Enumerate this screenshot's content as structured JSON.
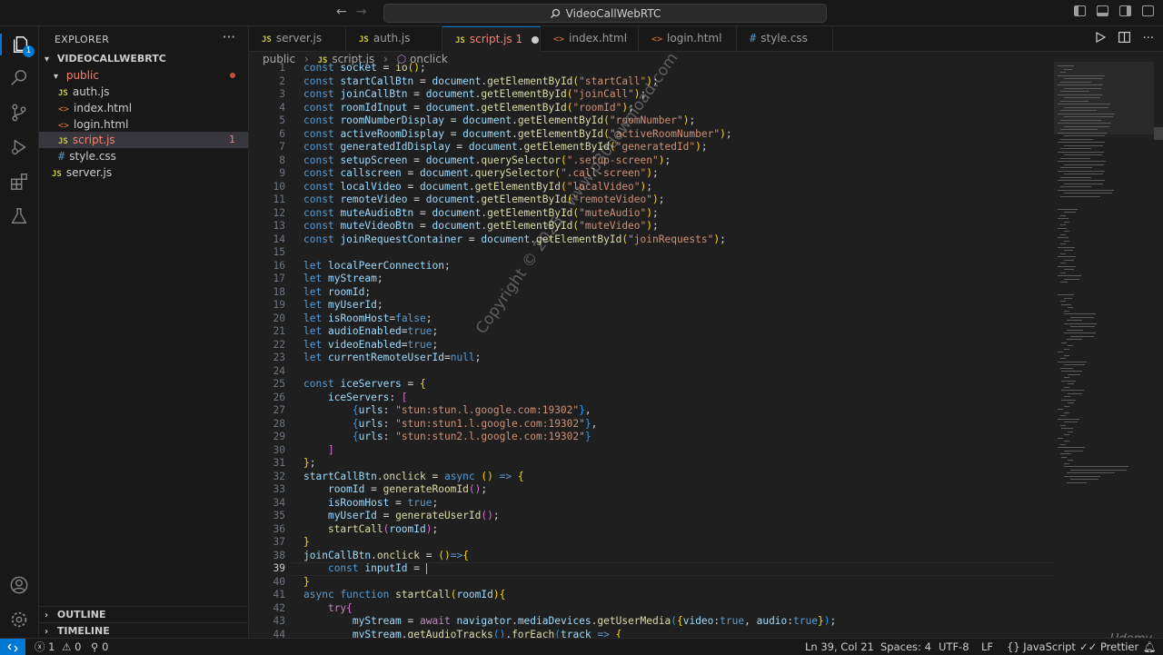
{
  "titlebar": {
    "title": "VideoCallWebRTC",
    "back": "←",
    "forward": "→"
  },
  "sidebar": {
    "title": "EXPLORER",
    "more": "···",
    "project": "VIDEOCALLWEBRTC",
    "folder": "public",
    "files": [
      {
        "name": "auth.js",
        "icon": "JS"
      },
      {
        "name": "index.html",
        "icon": "<>"
      },
      {
        "name": "login.html",
        "icon": "<>"
      },
      {
        "name": "script.js",
        "icon": "JS",
        "problems": "1"
      },
      {
        "name": "style.css",
        "icon": "#"
      }
    ],
    "root_files": [
      {
        "name": "server.js",
        "icon": "JS"
      }
    ],
    "outline": "OUTLINE",
    "timeline": "TIMELINE"
  },
  "activity": {
    "explorer_badge": "1"
  },
  "tabs": [
    {
      "icon": "JS",
      "label": "server.js"
    },
    {
      "icon": "JS",
      "label": "auth.js"
    },
    {
      "icon": "JS",
      "label": "script.js",
      "problems": "1"
    },
    {
      "icon": "<>",
      "label": "index.html"
    },
    {
      "icon": "<>",
      "label": "login.html"
    },
    {
      "icon": "#",
      "label": "style.css"
    }
  ],
  "breadcrumb": {
    "folder": "public",
    "file_icon": "JS",
    "file": "script.js",
    "symbol": "onclick"
  },
  "editor": {
    "current_line": 39,
    "lines": [
      {
        "n": 1,
        "html": "<span class='k'>const</span> <span class='v'>socket</span> = <span class='f'>io</span><span class='p1'>()</span>;"
      },
      {
        "n": 2,
        "html": "<span class='k'>const</span> <span class='v'>startCallBtn</span> = <span class='v'>document</span>.<span class='f'>getElementById</span><span class='p1'>(</span><span class='s'>\"startCall\"</span><span class='p1'>)</span>;"
      },
      {
        "n": 3,
        "html": "<span class='k'>const</span> <span class='v'>joinCallBtn</span> = <span class='v'>document</span>.<span class='f'>getElementById</span><span class='p1'>(</span><span class='s'>\"joinCall\"</span><span class='p1'>)</span>;"
      },
      {
        "n": 4,
        "html": "<span class='k'>const</span> <span class='v'>roomIdInput</span> = <span class='v'>document</span>.<span class='f'>getElementById</span><span class='p1'>(</span><span class='s'>\"roomId\"</span><span class='p1'>)</span>;"
      },
      {
        "n": 5,
        "html": "<span class='k'>const</span> <span class='v'>roomNumberDisplay</span> = <span class='v'>document</span>.<span class='f'>getElementById</span><span class='p1'>(</span><span class='s'>\"roomNumber\"</span><span class='p1'>)</span>;"
      },
      {
        "n": 6,
        "html": "<span class='k'>const</span> <span class='v'>activeRoomDisplay</span> = <span class='v'>document</span>.<span class='f'>getElementById</span><span class='p1'>(</span><span class='s'>\"activeRoomNumber\"</span><span class='p1'>)</span>;"
      },
      {
        "n": 7,
        "html": "<span class='k'>const</span> <span class='v'>generatedIdDisplay</span> = <span class='v'>document</span>.<span class='f'>getElementById</span><span class='p1'>(</span><span class='s'>\"generatedId\"</span><span class='p1'>)</span>;"
      },
      {
        "n": 8,
        "html": "<span class='k'>const</span> <span class='v'>setupScreen</span> = <span class='v'>document</span>.<span class='f'>querySelector</span><span class='p1'>(</span><span class='s'>\".setup-screen\"</span><span class='p1'>)</span>;"
      },
      {
        "n": 9,
        "html": "<span class='k'>const</span> <span class='v'>callscreen</span> = <span class='v'>document</span>.<span class='f'>querySelector</span><span class='p1'>(</span><span class='s'>\".call-screen\"</span><span class='p1'>)</span>;"
      },
      {
        "n": 10,
        "html": "<span class='k'>const</span> <span class='v'>localVideo</span> = <span class='v'>document</span>.<span class='f'>getElementById</span><span class='p1'>(</span><span class='s'>\"localVideo\"</span><span class='p1'>)</span>;"
      },
      {
        "n": 11,
        "html": "<span class='k'>const</span> <span class='v'>remoteVideo</span> = <span class='v'>document</span>.<span class='f'>getElementById</span><span class='p1'>(</span><span class='s'>\"remoteVideo\"</span><span class='p1'>)</span>;"
      },
      {
        "n": 12,
        "html": "<span class='k'>const</span> <span class='v'>muteAudioBtn</span> = <span class='v'>document</span>.<span class='f'>getElementById</span><span class='p1'>(</span><span class='s'>\"muteAudio\"</span><span class='p1'>)</span>;"
      },
      {
        "n": 13,
        "html": "<span class='k'>const</span> <span class='v'>muteVideoBtn</span> = <span class='v'>document</span>.<span class='f'>getElementById</span><span class='p1'>(</span><span class='s'>\"muteVideo\"</span><span class='p1'>)</span>;"
      },
      {
        "n": 14,
        "html": "<span class='k'>const</span> <span class='v'>joinRequestContainer</span> = <span class='v'>document</span>.<span class='f'>getElementById</span><span class='p1'>(</span><span class='s'>\"joinRequests\"</span><span class='p1'>)</span>;"
      },
      {
        "n": 15,
        "html": ""
      },
      {
        "n": 16,
        "html": "<span class='k'>let</span> <span class='v'>localPeerConnection</span>;"
      },
      {
        "n": 17,
        "html": "<span class='k'>let</span> <span class='v'>myStream</span>;"
      },
      {
        "n": 18,
        "html": "<span class='k'>let</span> <span class='v'>roomId</span>;"
      },
      {
        "n": 19,
        "html": "<span class='k'>let</span> <span class='v'>myUserId</span>;"
      },
      {
        "n": 20,
        "html": "<span class='k'>let</span> <span class='v'>isRoomHost</span>=<span class='k'>false</span>;"
      },
      {
        "n": 21,
        "html": "<span class='k'>let</span> <span class='v'>audioEnabled</span>=<span class='k'>true</span>;"
      },
      {
        "n": 22,
        "html": "<span class='k'>let</span> <span class='v'>videoEnabled</span>=<span class='k'>true</span>;"
      },
      {
        "n": 23,
        "html": "<span class='k'>let</span> <span class='v'>currentRemoteUserId</span>=<span class='k'>null</span>;"
      },
      {
        "n": 24,
        "html": ""
      },
      {
        "n": 25,
        "html": "<span class='k'>const</span> <span class='v'>iceServers</span> = <span class='p1'>{</span>"
      },
      {
        "n": 26,
        "html": "    <span class='v'>iceServers</span>: <span class='p2'>[</span>"
      },
      {
        "n": 27,
        "html": "        <span class='p3'>{</span><span class='v'>urls</span>: <span class='s'>\"stun:stun.l.google.com:19302\"</span><span class='p3'>}</span>,"
      },
      {
        "n": 28,
        "html": "        <span class='p3'>{</span><span class='v'>urls</span>: <span class='s'>\"stun:stun1.l.google.com:19302\"</span><span class='p3'>}</span>,"
      },
      {
        "n": 29,
        "html": "        <span class='p3'>{</span><span class='v'>urls</span>: <span class='s'>\"stun:stun2.l.google.com:19302\"</span><span class='p3'>}</span>"
      },
      {
        "n": 30,
        "html": "    <span class='p2'>]</span>"
      },
      {
        "n": 31,
        "html": "<span class='p1'>}</span>;"
      },
      {
        "n": 32,
        "html": "<span class='v'>startCallBtn</span>.<span class='f'>onclick</span> = <span class='k'>async</span> <span class='p1'>()</span> <span class='k'>=&gt;</span> <span class='p1'>{</span>"
      },
      {
        "n": 33,
        "html": "    <span class='v'>roomId</span> = <span class='f'>generateRoomId</span><span class='p2'>()</span>;"
      },
      {
        "n": 34,
        "html": "    <span class='v'>isRoomHost</span> = <span class='k'>true</span>;"
      },
      {
        "n": 35,
        "html": "    <span class='v'>myUserId</span> = <span class='f'>generateUserId</span><span class='p2'>()</span>;"
      },
      {
        "n": 36,
        "html": "    <span class='f'>startCall</span><span class='p2'>(</span><span class='v'>roomId</span><span class='p2'>)</span>;"
      },
      {
        "n": 37,
        "html": "<span class='p1'>}</span>"
      },
      {
        "n": 38,
        "html": "<span class='v'>joinCallBtn</span>.<span class='f'>onclick</span> = <span class='p1'>()</span><span class='k'>=&gt;</span><span class='p1'>{</span>"
      },
      {
        "n": 39,
        "html": "    <span class='k'>const</span> <span class='v'>inputId</span> = <span class='caret'></span>"
      },
      {
        "n": 40,
        "html": "<span class='p1'>}</span>"
      },
      {
        "n": 41,
        "html": "<span class='k'>async</span> <span class='k'>function</span> <span class='f'>startCall</span><span class='p1'>(</span><span class='v'>roomId</span><span class='p1'>)</span><span class='p1'>{</span>"
      },
      {
        "n": 42,
        "html": "    <span class='kw2'>try</span><span class='p2'>{</span>"
      },
      {
        "n": 43,
        "html": "        <span class='v'>myStream</span> = <span class='kw2'>await</span> <span class='v'>navigator</span>.<span class='v'>mediaDevices</span>.<span class='f'>getUserMedia</span><span class='p3'>(</span><span class='p1'>{</span><span class='v'>video</span>:<span class='k'>true</span>, <span class='v'>audio</span>:<span class='k'>true</span><span class='p1'>}</span><span class='p3'>)</span>;"
      },
      {
        "n": 44,
        "html": "        <span class='v'>myStream</span>.<span class='f'>getAudioTracks</span><span class='p3'>()</span>.<span class='f'>forEach</span><span class='p3'>(</span><span class='v'>track</span> <span class='k'>=&gt;</span> <span class='p1'>{</span>"
      }
    ]
  },
  "watermark": "Copyright © 2025 - www.p30download.com",
  "udemy": "Udemy",
  "status": {
    "errors": "1",
    "warnings": "0",
    "ports": "0",
    "position": "Ln 39, Col 21",
    "spaces": "Spaces: 4",
    "encoding": "UTF-8",
    "eol": "LF",
    "language": "JavaScript",
    "formatter": "Prettier"
  }
}
